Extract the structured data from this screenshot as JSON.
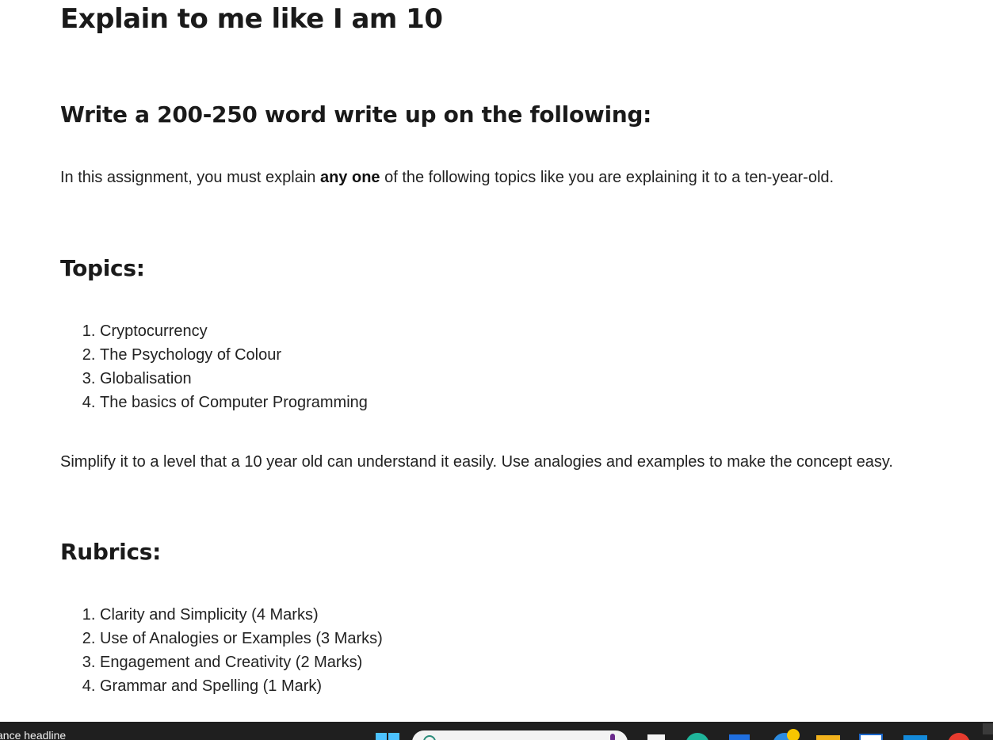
{
  "document": {
    "title": "Explain to me like I am 10",
    "subtitle": "Write a 200-250 word write up on the following:",
    "intro_before": "In this assignment, you must explain ",
    "intro_bold": "any one",
    "intro_after": " of the following topics like you are explaining it to a ten-year-old.",
    "topics_heading": "Topics:",
    "topics": [
      "Cryptocurrency",
      "The Psychology of Colour",
      "Globalisation",
      "The basics of Computer Programming"
    ],
    "instruction": "Simplify it to a level that a 10 year old can understand it easily. Use analogies and examples to make the concept easy.",
    "rubrics_heading": "Rubrics:",
    "rubrics": [
      "Clarity and Simplicity (4 Marks)",
      "Use of Analogies or Examples (3 Marks)",
      "Engagement and Creativity (2 Marks)",
      "Grammar and Spelling (1 Mark)"
    ]
  },
  "taskbar": {
    "headline_text": "ance headline",
    "icons": [
      "windows-start-icon",
      "search-icon",
      "microphone-icon",
      "task-view-icon",
      "copilot-icon",
      "vscode-icon",
      "edge-icon",
      "file-explorer-icon",
      "printer-icon",
      "mail-icon",
      "app-red-icon"
    ],
    "colors": {
      "background": "#1f1f1f",
      "start_accent": "#4cc2ff"
    }
  }
}
